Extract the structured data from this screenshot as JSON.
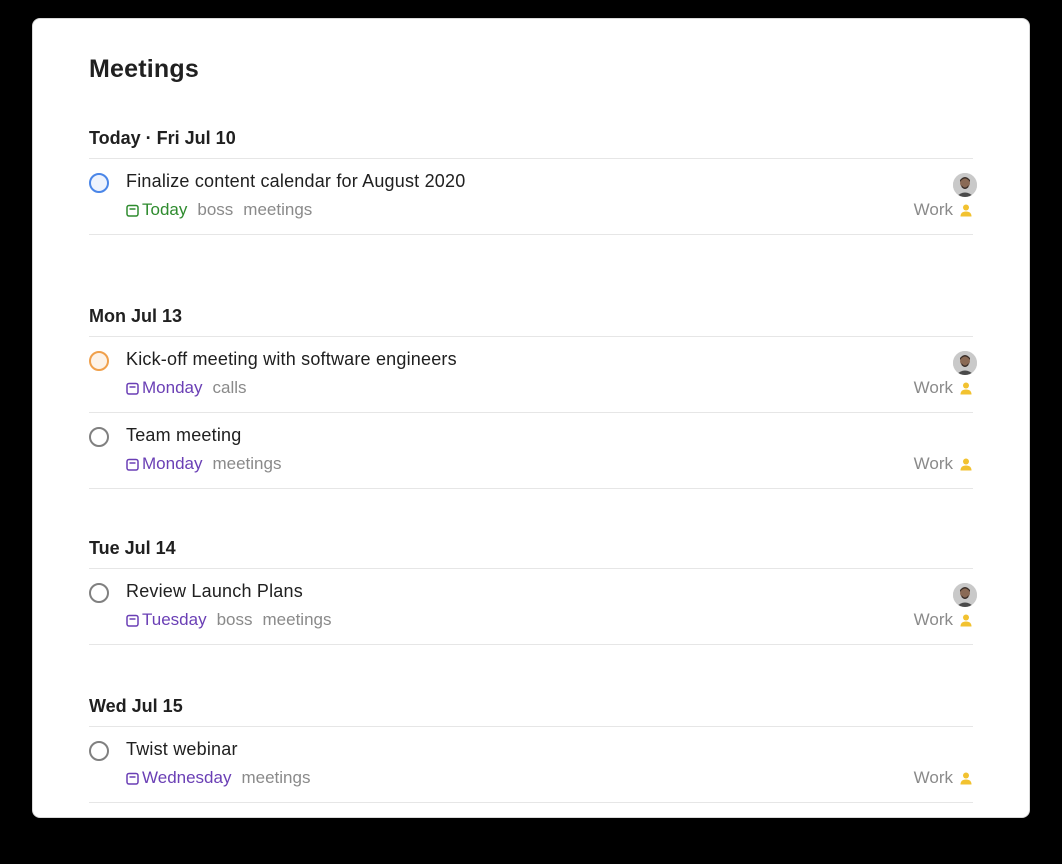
{
  "page": {
    "title": "Meetings"
  },
  "sections": [
    {
      "header": "Today · Fri Jul 10",
      "tasks": [
        {
          "title": "Finalize content calendar for August 2020",
          "due": "Today",
          "labels": [
            "boss",
            "meetings"
          ],
          "project": "Work",
          "priority": "p2",
          "has_avatar": true
        }
      ]
    },
    {
      "header": "Mon Jul 13",
      "tasks": [
        {
          "title": "Kick-off meeting with software engineers",
          "due": "Monday",
          "labels": [
            "calls"
          ],
          "project": "Work",
          "priority": "p3",
          "has_avatar": true
        },
        {
          "title": "Team meeting",
          "due": "Monday",
          "labels": [
            "meetings"
          ],
          "project": "Work",
          "priority": "p4",
          "has_avatar": false
        }
      ]
    },
    {
      "header": "Tue Jul 14",
      "tasks": [
        {
          "title": "Review Launch Plans",
          "due": "Tuesday",
          "labels": [
            "boss",
            "meetings"
          ],
          "project": "Work",
          "priority": "p4",
          "has_avatar": true
        }
      ]
    },
    {
      "header": "Wed Jul 15",
      "tasks": [
        {
          "title": "Twist webinar",
          "due": "Wednesday",
          "labels": [
            "meetings"
          ],
          "project": "Work",
          "priority": "p4",
          "has_avatar": false
        }
      ]
    }
  ],
  "colors": {
    "due_today": "#2e8b2e",
    "due_upcoming": "#6a3fb5",
    "priority_2": "#4a86e8",
    "priority_3": "#f0a04b",
    "project_person_icon": "#f2c230"
  },
  "icons": {
    "due": "calendar-icon",
    "project": "person-icon",
    "assignee": "avatar"
  }
}
